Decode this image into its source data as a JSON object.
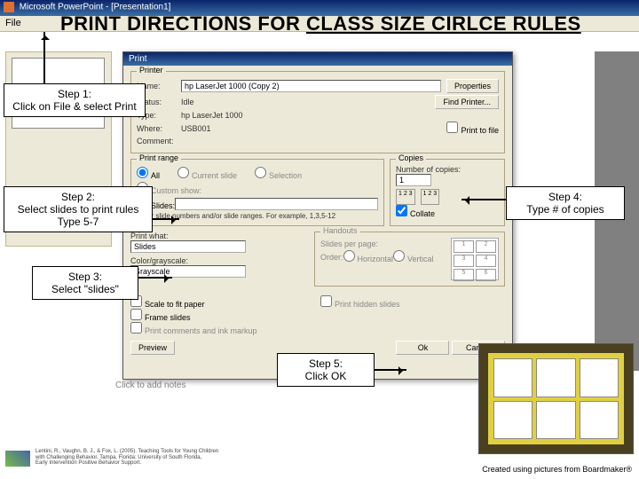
{
  "titlebar": {
    "app_title": "Microsoft PowerPoint - [Presentation1]"
  },
  "menubar": {
    "file": "File"
  },
  "heading": {
    "prefix": "PRINT DIRECTIONS FOR ",
    "underlined": "CLASS SIZE CIRLCE RULES"
  },
  "dialog": {
    "title": "Print",
    "printer": {
      "legend": "Printer",
      "name_label": "Name:",
      "name_value": "hp LaserJet 1000 (Copy 2)",
      "status_label": "Status:",
      "status_value": "Idle",
      "type_label": "Type:",
      "type_value": "hp LaserJet 1000",
      "where_label": "Where:",
      "where_value": "USB001",
      "comment_label": "Comment:",
      "properties_btn": "Properties",
      "find_btn": "Find Printer...",
      "print_to_file": "Print to file"
    },
    "range": {
      "legend": "Print range",
      "all": "All",
      "current": "Current slide",
      "selection": "Selection",
      "custom_show": "Custom show:",
      "slides": "Slides:",
      "hint": "Enter slide numbers and/or slide ranges. For example, 1,3,5-12"
    },
    "copies": {
      "legend": "Copies",
      "num_label": "Number of copies:",
      "num_value": "1",
      "collate": "Collate"
    },
    "print_what": {
      "legend": "Print what:",
      "value": "Slides",
      "color_label": "Color/grayscale:",
      "color_value": "Grayscale"
    },
    "handouts": {
      "legend": "Handouts",
      "slides_per_label": "Slides per page:",
      "order_label": "Order:",
      "horizontal": "Horizontal",
      "vertical": "Vertical"
    },
    "options": {
      "scale": "Scale to fit paper",
      "frame": "Frame slides",
      "comments": "Print comments and ink markup",
      "hidden": "Print hidden slides"
    },
    "buttons": {
      "preview": "Preview",
      "ok": "Ok",
      "cancel": "Cancel"
    }
  },
  "callouts": {
    "step1_title": "Step 1:",
    "step1_text": "Click on File &  select Print",
    "step2_title": "Step 2:",
    "step2_text1": "Select slides to print rules",
    "step2_text2": "Type 5-7",
    "step3_title": "Step 3:",
    "step3_text": "Select \"slides\"",
    "step4_title": "Step 4:",
    "step4_text": "Type # of copies",
    "step5_title": "Step 5:",
    "step5_text": "Click OK"
  },
  "misc": {
    "click_add": "Click to add notes"
  },
  "footer": {
    "citation_line1": "Lentini, R., Vaughn, B. J., & Fox, L. (2005). Teaching Tools for Young Children",
    "citation_line2": "with Challenging Behavior. Tampa, Florida: University of South Florida,",
    "citation_line3": "Early Intervention Positive Behavior Support.",
    "credit": "Created using pictures from Boardmaker®"
  }
}
